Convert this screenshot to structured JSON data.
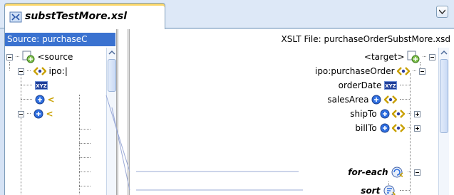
{
  "tab": {
    "title": "substTestMore.xsl",
    "icon": "xsl-file-icon"
  },
  "source": {
    "header": "Source: purchaseC",
    "nodes": [
      {
        "label": "<source",
        "icon": "document-node-icon"
      },
      {
        "label": "ipo:|",
        "icon": "element-angle-icon"
      },
      {
        "label": "",
        "icon": "xyz-text-icon"
      },
      {
        "label": "<",
        "icon": "blue-attr-icon"
      },
      {
        "label": "<",
        "icon": "blue-attr-icon"
      }
    ]
  },
  "target": {
    "header": "XSLT File: purchaseOrderSubstMore.xsd",
    "nodes": [
      {
        "label": "<target>",
        "icon": "document-node-icon"
      },
      {
        "label": "ipo:purchaseOrder",
        "icon": "element-angle-icon"
      },
      {
        "label": "orderDate",
        "icon": "xyz-text-icon"
      },
      {
        "label": "salesArea",
        "icon": "blue-attr-icon"
      },
      {
        "label": "shipTo",
        "icon": "blue-attr-icon"
      },
      {
        "label": "billTo",
        "icon": "blue-attr-icon"
      },
      {
        "label": "for-each",
        "icon": "for-each-icon"
      },
      {
        "label": "sort",
        "icon": "sort-icon"
      }
    ]
  },
  "colors": {
    "selection": "#3a72d0",
    "tab_highlight": "#fbd76a",
    "border": "#7f9db9"
  }
}
